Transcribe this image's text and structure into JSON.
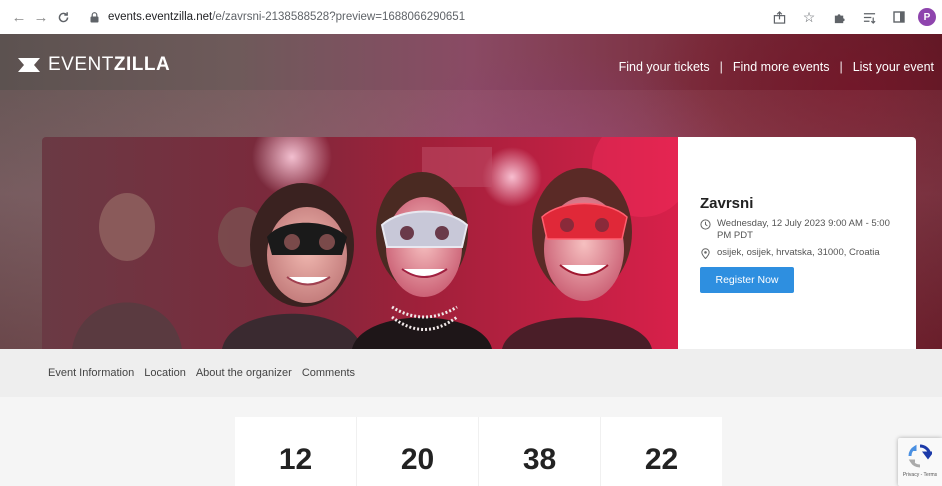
{
  "browser": {
    "url_host": "events.eventzilla.net",
    "url_path": "/e/zavrsni-2138588528?preview=1688066290651",
    "profile_initial": "P"
  },
  "header": {
    "logo_light": "EVENT",
    "logo_bold": "ZILLA",
    "nav": [
      "Find your tickets",
      "Find more events",
      "List your event"
    ],
    "separator": "|"
  },
  "event": {
    "title": "Zavrsni",
    "datetime": "Wednesday, 12 July 2023 9:00 AM - 5:00 PM PDT",
    "location": "osijek, osijek, hrvatska, 31000, Croatia",
    "register_label": "Register Now",
    "accent_color": "#2e8fe0"
  },
  "subnav": [
    "Event Information",
    "Location",
    "About the organizer",
    "Comments"
  ],
  "countdown": [
    "12",
    "20",
    "38",
    "22"
  ],
  "recaptcha": {
    "label": "Privacy - Terms"
  }
}
